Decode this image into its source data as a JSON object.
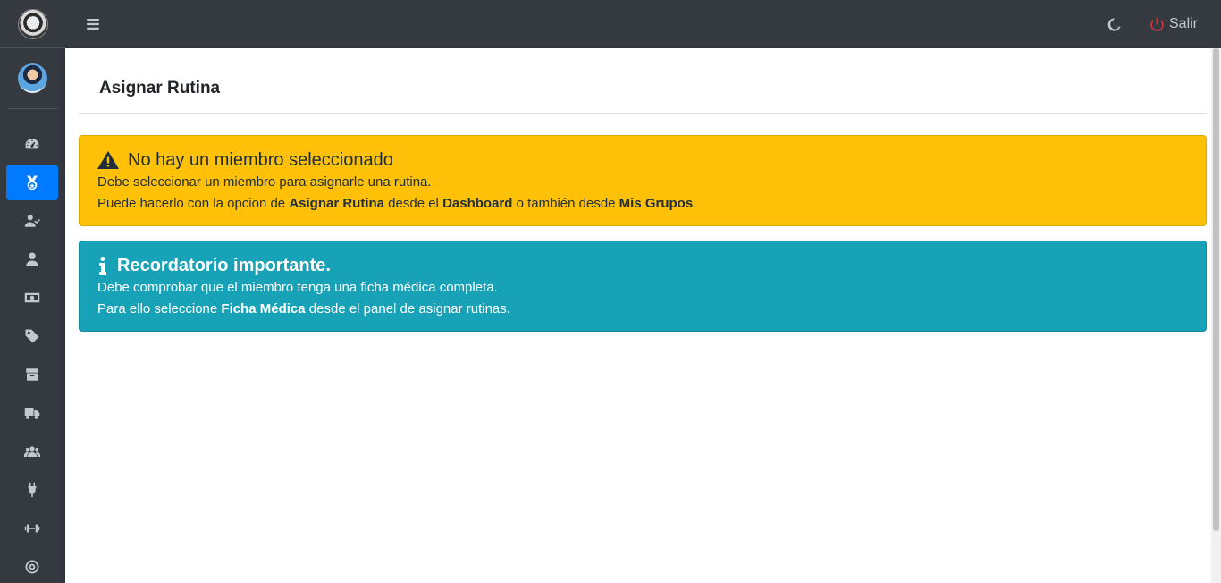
{
  "navbar": {
    "menu_icon": "bars-icon",
    "theme_icon": "moon-icon",
    "logout_icon": "power-icon",
    "logout_label": "Salir",
    "logout_icon_color": "#dc3545"
  },
  "sidebar": {
    "brand_icon": "gym-logo",
    "active_color": "#007bff",
    "items": [
      {
        "icon": "tachometer-icon",
        "active": false
      },
      {
        "icon": "medal-icon",
        "active": true
      },
      {
        "icon": "user-check-icon",
        "active": false
      },
      {
        "icon": "user-icon",
        "active": false
      },
      {
        "icon": "money-bill-icon",
        "active": false
      },
      {
        "icon": "tag-icon",
        "active": false
      },
      {
        "icon": "box-icon",
        "active": false
      },
      {
        "icon": "truck-icon",
        "active": false
      },
      {
        "icon": "users-icon",
        "active": false
      },
      {
        "icon": "plug-icon",
        "active": false
      },
      {
        "icon": "dumbbell-icon",
        "active": false
      },
      {
        "icon": "bullseye-icon",
        "active": false
      }
    ]
  },
  "page": {
    "title": "Asignar Rutina"
  },
  "alerts": {
    "warning": {
      "icon": "exclamation-triangle-icon",
      "heading": "No hay un miembro seleccionado",
      "line1": "Debe seleccionar un miembro para asignarle una rutina.",
      "line2_prefix": "Puede hacerlo con la opcion de ",
      "line2_b1": "Asignar Rutina",
      "line2_mid1": " desde el ",
      "line2_b2": "Dashboard",
      "line2_mid2": " o también desde ",
      "line2_b3": "Mis Grupos",
      "line2_suffix": ".",
      "color": "#ffc107"
    },
    "info": {
      "icon": "info-icon",
      "heading": "Recordatorio importante.",
      "line1": "Debe comprobar que el miembro tenga una ficha médica completa.",
      "line2_prefix": "Para ello seleccione ",
      "line2_b1": "Ficha Médica",
      "line2_suffix": " desde el panel de asignar rutinas.",
      "color": "#17a2b8"
    }
  }
}
